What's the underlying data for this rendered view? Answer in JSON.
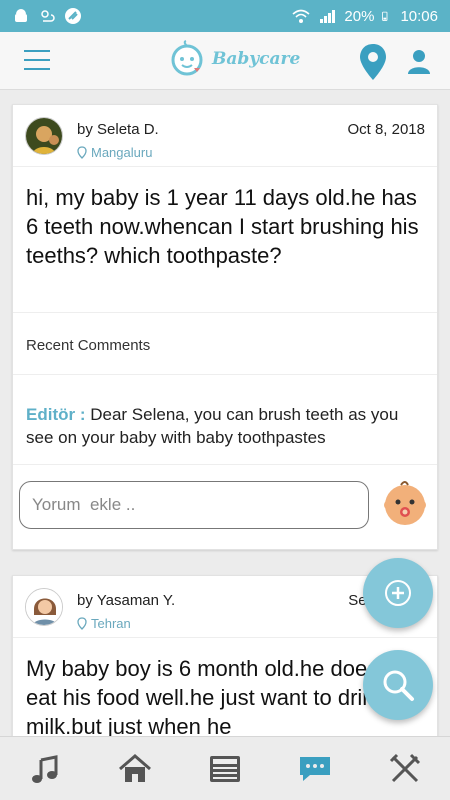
{
  "status_bar": {
    "battery": "20%",
    "time": "10:06",
    "icons_left": [
      "android-logo-icon",
      "weather-icon",
      "app-notification-icon"
    ],
    "icons_right": [
      "wifi-icon",
      "signal-icon",
      "battery-icon"
    ]
  },
  "header": {
    "app_name": "Babycare",
    "menu_icon": "hamburger-menu-icon",
    "location_icon": "map-pin-icon",
    "profile_icon": "user-icon"
  },
  "posts": [
    {
      "author": "by Seleta D.",
      "location": "Mangaluru",
      "date": "Oct 8, 2018",
      "question": "hi, my baby is 1 year 11 days old.he has 6 teeth now.whencan I start brushing his teeths? which toothpaste?",
      "recent_comments_label": "Recent Comments",
      "editor_label": "Editör :",
      "editor_comment": " Dear Selena, you can brush teeth as you see on your baby with baby toothpastes",
      "comment_placeholder": "Yorum  ekle .."
    },
    {
      "author": "by Yasaman Y.",
      "location": "Tehran",
      "date": "Sep",
      "question": "My baby boy is 6 month old.he doesnt eat his food well.he just want to drink milk.but just when he"
    }
  ],
  "fabs": [
    "add-icon",
    "search-icon"
  ],
  "bottom_nav": [
    "music-icon",
    "home-icon",
    "news-icon",
    "chat-icon",
    "utensils-icon"
  ],
  "colors": {
    "status_bar": "#5bb3c7",
    "accent": "#3a9fc0",
    "fab": "#84c7d9",
    "editor_label": "#5fb0c8"
  }
}
